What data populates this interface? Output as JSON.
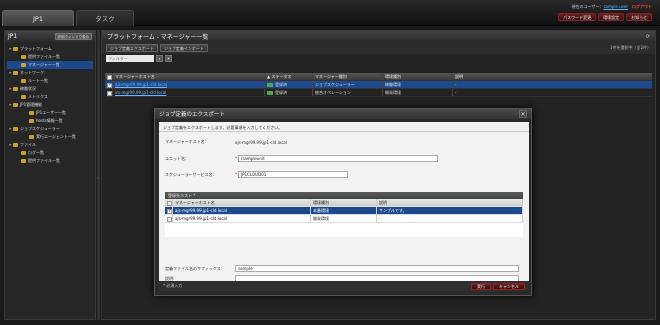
{
  "tabs": [
    {
      "label": "JP1"
    },
    {
      "label": "タスク"
    }
  ],
  "user": {
    "prefix": "現在のユーザー：",
    "name": "sample.user",
    "logout": "ログアウト"
  },
  "top_buttons": [
    "パスワード変更",
    "環境設定",
    "お知らせ"
  ],
  "left": {
    "title": "JP1",
    "collapse_button": "詳細ウィンドウ表示",
    "tree": [
      {
        "label": "プラットフォーム",
        "level": 1,
        "expanded": true,
        "icon": "folder"
      },
      {
        "label": "提供ファイル一覧",
        "level": 2,
        "icon": "folder"
      },
      {
        "label": "マネージャー一覧",
        "level": 2,
        "icon": "folder",
        "selected": true
      },
      {
        "label": "ネットワーク",
        "level": 1,
        "expanded": true,
        "icon": "folder"
      },
      {
        "label": "ルート一覧",
        "level": 2,
        "icon": "folder"
      },
      {
        "label": "稼働状況",
        "level": 1,
        "expanded": true,
        "icon": "folder"
      },
      {
        "label": "メトリクス",
        "level": 2,
        "icon": "folder"
      },
      {
        "label": "JP1管理機能",
        "level": 1,
        "expanded": true,
        "icon": "folder"
      },
      {
        "label": "JP1ユーザー一覧",
        "level": 3,
        "icon": "folder"
      },
      {
        "label": "hosts情報一覧",
        "level": 3,
        "icon": "folder"
      },
      {
        "label": "ジョブスケジューラー",
        "level": 1,
        "expanded": true,
        "icon": "folder"
      },
      {
        "label": "実行エージェント一覧",
        "level": 3,
        "icon": "folder"
      },
      {
        "label": "ファイル",
        "level": 1,
        "expanded": true,
        "icon": "folder"
      },
      {
        "label": "ログ一覧",
        "level": 2,
        "icon": "folder"
      },
      {
        "label": "提供ファイル一覧",
        "level": 2,
        "icon": "folder"
      }
    ]
  },
  "main": {
    "title": "プラットフォーム - マネージャー一覧",
    "toolbar": {
      "export": "ジョブ定義エクスポート",
      "import": "ジョブ定義インポート",
      "selected_count": "1件を選択中（全2件）"
    },
    "filter_placeholder": "フィルター",
    "columns": [
      "マネージャーホスト名",
      "▲ ステータス",
      "マネージャー種別",
      "環境種別",
      "説明"
    ],
    "rows": [
      {
        "host": "ajs-mgr99.99.jp1-cld.local",
        "status": "登録済",
        "type": "ジョブスケジューラー",
        "env": "稼働環境",
        "desc": "-",
        "checked": true,
        "selected": true
      },
      {
        "host": "im-mgr99.99.jp1-cld.local",
        "status": "登録済",
        "type": "統合オペレーション",
        "env": "開発環境",
        "desc": "-",
        "checked": false,
        "selected": false
      }
    ]
  },
  "dialog": {
    "title": "ジョブ定義のエクスポート",
    "info": "ジョブ定義をエクスポートします。必要事項を入力してください。",
    "host_label": "マネージャーホスト名:",
    "host_value": "ajs-mgr99.99.jp1-cld.local",
    "unit_label": "ユニット名:",
    "unit_value": "/sampleunit",
    "service_label": "スケジューラーサービス名:",
    "service_value": "JP1CLOUD01",
    "section_title": "登録先ホスト *",
    "sub_columns": [
      "マネージャーホスト名",
      "環境種別",
      "説明"
    ],
    "sub_rows": [
      {
        "host": "ajs-mgr99.99.jp1-cld.local",
        "env": "本番環境",
        "desc": "サンプルです。",
        "checked": true,
        "selected": true
      },
      {
        "host": "ajs-mgr99.99.jp1-cld.local",
        "env": "開発環境",
        "desc": "-",
        "checked": false,
        "selected": false
      }
    ],
    "suffix_label": "定義ファイル名のサフィックス:",
    "suffix_value": "sample",
    "desc_label": "説明:",
    "desc_value": "",
    "required_note": "* 必須入力",
    "ok": "実行",
    "cancel": "キャンセル"
  }
}
